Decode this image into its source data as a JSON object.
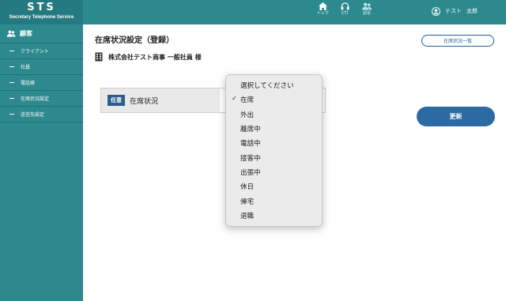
{
  "brand": {
    "title": "STS",
    "subtitle": "Secretary Telephone Service"
  },
  "nav": [
    {
      "label": "トップ",
      "icon": "home-icon"
    },
    {
      "label": "CTI",
      "icon": "headset-icon"
    },
    {
      "label": "顧客",
      "icon": "customer-icon",
      "active": true
    }
  ],
  "user": {
    "name": "テスト",
    "name2": "太郎",
    "icon": "user-avatar-icon"
  },
  "sidebar": {
    "header": "顧客",
    "items": [
      {
        "label": "クライアント"
      },
      {
        "label": "社員"
      },
      {
        "label": "電話帳"
      },
      {
        "label": "在席状況設定"
      },
      {
        "label": "送信先設定"
      }
    ]
  },
  "main": {
    "title": "在席状況設定（登録）",
    "list_button": "在席状況一覧",
    "company": "株式会社テスト商事 一般社員 様",
    "badge": "任意",
    "field_label": "在席状況",
    "update_button": "更新"
  },
  "dropdown": {
    "selected": "在席",
    "options": [
      "選択してください",
      "在席",
      "外出",
      "離席中",
      "電話中",
      "接客中",
      "出張中",
      "休日",
      "帰宅",
      "退職"
    ]
  },
  "colors": {
    "header": "#2c8a8e",
    "brand_bg": "#247a80",
    "accent_blue": "#2b6aa3",
    "badge": "#2d5f8d"
  }
}
